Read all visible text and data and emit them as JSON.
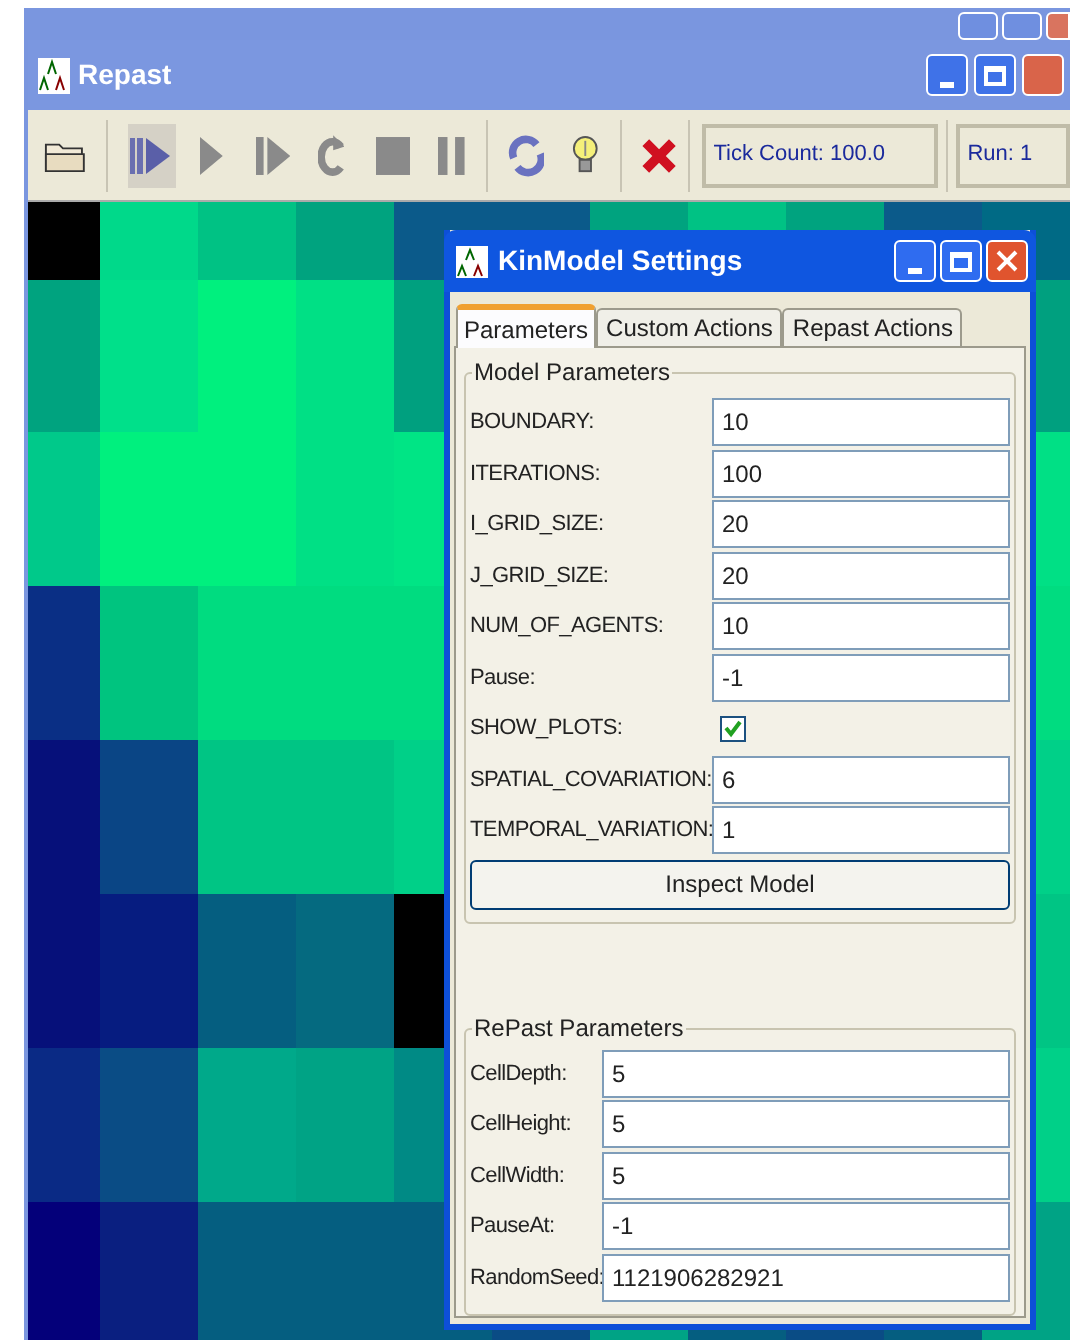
{
  "main_window": {
    "title": "Repast",
    "tick_count": "Tick Count: 100.0",
    "run": "Run: 1"
  },
  "dialog": {
    "title": "KinModel Settings",
    "tabs": [
      {
        "label": "Parameters",
        "selected": true
      },
      {
        "label": "Custom Actions",
        "selected": false
      },
      {
        "label": "Repast Actions",
        "selected": false
      }
    ],
    "model_parameters": {
      "title": "Model Parameters",
      "fields": [
        {
          "kind": "text",
          "label": "BOUNDARY:",
          "value": "10"
        },
        {
          "kind": "text",
          "label": "ITERATIONS:",
          "value": "100"
        },
        {
          "kind": "text",
          "label": "I_GRID_SIZE:",
          "value": "20"
        },
        {
          "kind": "text",
          "label": "J_GRID_SIZE:",
          "value": "20"
        },
        {
          "kind": "text",
          "label": "NUM_OF_AGENTS:",
          "value": "10"
        },
        {
          "kind": "text",
          "label": "Pause:",
          "value": "-1"
        },
        {
          "kind": "checkbox",
          "label": "SHOW_PLOTS:",
          "checked": true
        },
        {
          "kind": "text",
          "label": "SPATIAL_COVARIATION:",
          "value": "6"
        },
        {
          "kind": "text",
          "label": "TEMPORAL_VARIATION:",
          "value": "1"
        }
      ],
      "button": "Inspect Model"
    },
    "repast_parameters": {
      "title": "RePast Parameters",
      "fields": [
        {
          "kind": "text",
          "label": "CellDepth:",
          "value": "5"
        },
        {
          "kind": "text",
          "label": "CellHeight:",
          "value": "5"
        },
        {
          "kind": "text",
          "label": "CellWidth:",
          "value": "5"
        },
        {
          "kind": "text",
          "label": "PauseAt:",
          "value": "-1"
        },
        {
          "kind": "text",
          "label": "RandomSeed:",
          "value": "1121906282921"
        }
      ]
    }
  }
}
